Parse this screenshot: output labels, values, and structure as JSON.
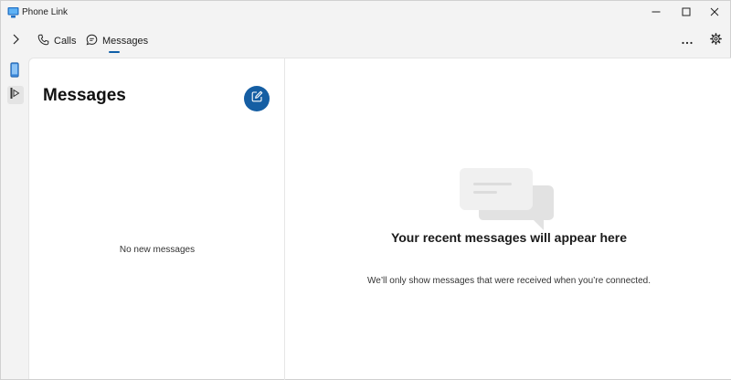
{
  "window": {
    "title": "Phone Link",
    "icon": "phone-link-app-icon",
    "controls": [
      "minimize-icon",
      "maximize-icon",
      "close-icon"
    ]
  },
  "nav": {
    "expand_icon": "chevron-right-icon",
    "tabs": [
      {
        "label": "Calls",
        "icon": "phone-icon",
        "selected": false
      },
      {
        "label": "Messages",
        "icon": "chat-bubble-icon",
        "selected": true
      }
    ],
    "more_icon": "ellipsis-icon",
    "settings_icon": "gear-icon"
  },
  "rail": {
    "items": [
      "phone-device-icon",
      "apps-icon"
    ]
  },
  "messages_pane": {
    "title": "Messages",
    "compose_icon": "compose-icon",
    "empty_text": "No new messages"
  },
  "detail_pane": {
    "illustration": "chat-bubbles-illustration",
    "title": "Your recent messages will appear here",
    "subtitle": "We’ll only show messages that were received when you’re connected."
  },
  "colors": {
    "accent": "#155ea3",
    "background": "#f3f3f3",
    "surface": "#ffffff"
  }
}
